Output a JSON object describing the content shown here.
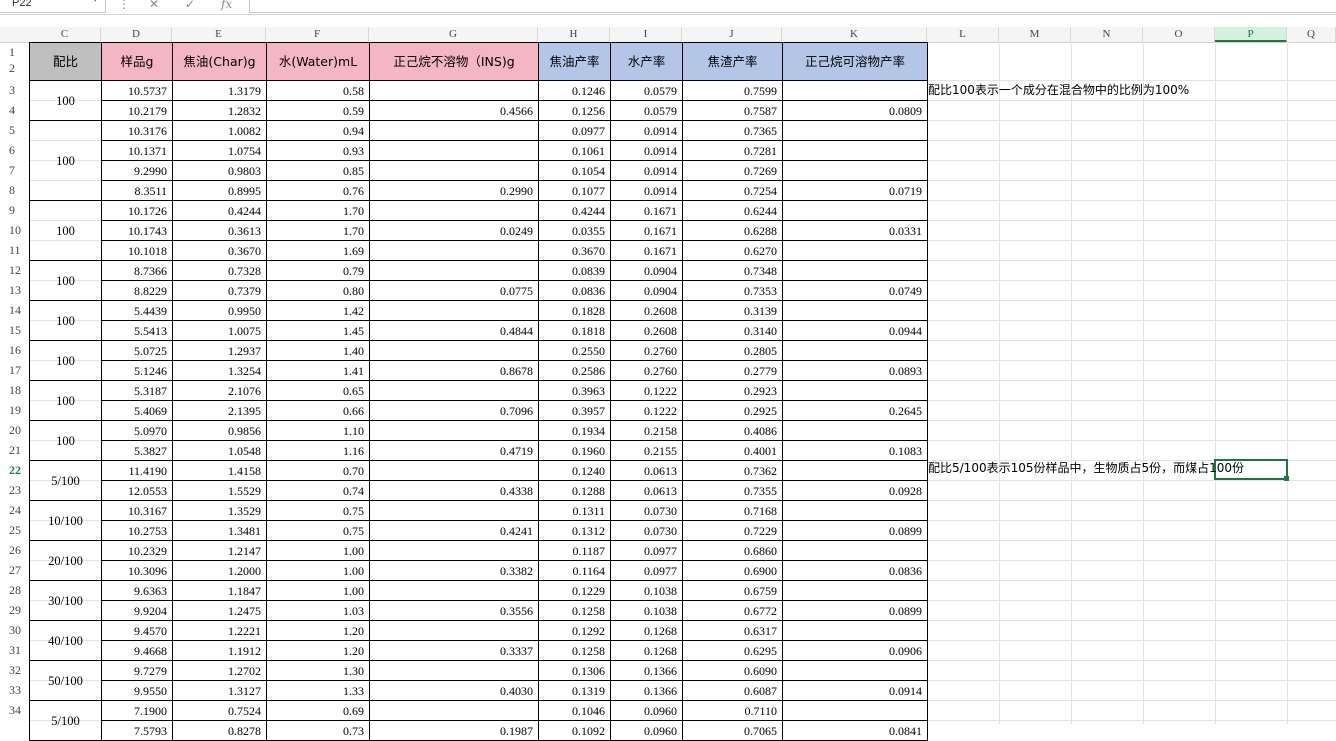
{
  "formula_bar": {
    "name_box": "P22",
    "cancel_icon": "✕",
    "confirm_icon": "✓",
    "fx_label": "fx",
    "formula": ""
  },
  "columns": [
    "C",
    "D",
    "E",
    "F",
    "G",
    "H",
    "I",
    "J",
    "K",
    "L",
    "M",
    "N",
    "O",
    "P",
    "Q"
  ],
  "selected_column": "P",
  "rows": [
    "1",
    "2",
    "3",
    "4",
    "5",
    "6",
    "7",
    "8",
    "9",
    "10",
    "11",
    "12",
    "13",
    "14",
    "15",
    "16",
    "17",
    "18",
    "19",
    "20",
    "21",
    "22",
    "23",
    "24",
    "25",
    "26",
    "27",
    "28",
    "29",
    "30",
    "31",
    "32",
    "33",
    "34",
    ""
  ],
  "selected_row": "22",
  "headers": {
    "ratio": "配比",
    "sample": "样品g",
    "char": "焦油(Char)g",
    "water": "水(Water)mL",
    "ins": "正己烷不溶物（INS)g",
    "char_yield": "焦油产率",
    "water_yield": "水产率",
    "residue_yield": "焦渣产率",
    "soluble_yield": "正己烷可溶物产率"
  },
  "groups": [
    {
      "ratio": "100",
      "rows": [
        {
          "sample": "10.5737",
          "char": "1.3179",
          "water": "0.58",
          "ins": "",
          "cy": "0.1246",
          "wy": "0.0579",
          "ry": "0.7599",
          "sy": ""
        },
        {
          "sample": "10.2179",
          "char": "1.2832",
          "water": "0.59",
          "ins": "0.4566",
          "cy": "0.1256",
          "wy": "0.0579",
          "ry": "0.7587",
          "sy": "0.0809"
        }
      ]
    },
    {
      "ratio": "100",
      "rows": [
        {
          "sample": "10.3176",
          "char": "1.0082",
          "water": "0.94",
          "ins": "",
          "cy": "0.0977",
          "wy": "0.0914",
          "ry": "0.7365",
          "sy": ""
        },
        {
          "sample": "10.1371",
          "char": "1.0754",
          "water": "0.93",
          "ins": "",
          "cy": "0.1061",
          "wy": "0.0914",
          "ry": "0.7281",
          "sy": ""
        },
        {
          "sample": "9.2990",
          "char": "0.9803",
          "water": "0.85",
          "ins": "",
          "cy": "0.1054",
          "wy": "0.0914",
          "ry": "0.7269",
          "sy": ""
        },
        {
          "sample": "8.3511",
          "char": "0.8995",
          "water": "0.76",
          "ins": "0.2990",
          "cy": "0.1077",
          "wy": "0.0914",
          "ry": "0.7254",
          "sy": "0.0719"
        }
      ]
    },
    {
      "ratio": "100",
      "rows": [
        {
          "sample": "10.1726",
          "char": "0.4244",
          "water": "1.70",
          "ins": "",
          "cy": "0.4244",
          "wy": "0.1671",
          "ry": "0.6244",
          "sy": ""
        },
        {
          "sample": "10.1743",
          "char": "0.3613",
          "water": "1.70",
          "ins": "0.0249",
          "cy": "0.0355",
          "wy": "0.1671",
          "ry": "0.6288",
          "sy": "0.0331"
        },
        {
          "sample": "10.1018",
          "char": "0.3670",
          "water": "1.69",
          "ins": "",
          "cy": "0.3670",
          "wy": "0.1671",
          "ry": "0.6270",
          "sy": ""
        }
      ]
    },
    {
      "ratio": "100",
      "rows": [
        {
          "sample": "8.7366",
          "char": "0.7328",
          "water": "0.79",
          "ins": "",
          "cy": "0.0839",
          "wy": "0.0904",
          "ry": "0.7348",
          "sy": ""
        },
        {
          "sample": "8.8229",
          "char": "0.7379",
          "water": "0.80",
          "ins": "0.0775",
          "cy": "0.0836",
          "wy": "0.0904",
          "ry": "0.7353",
          "sy": "0.0749"
        }
      ]
    },
    {
      "ratio": "100",
      "rows": [
        {
          "sample": "5.4439",
          "char": "0.9950",
          "water": "1.42",
          "ins": "",
          "cy": "0.1828",
          "wy": "0.2608",
          "ry": "0.3139",
          "sy": ""
        },
        {
          "sample": "5.5413",
          "char": "1.0075",
          "water": "1.45",
          "ins": "0.4844",
          "cy": "0.1818",
          "wy": "0.2608",
          "ry": "0.3140",
          "sy": "0.0944"
        }
      ]
    },
    {
      "ratio": "100",
      "rows": [
        {
          "sample": "5.0725",
          "char": "1.2937",
          "water": "1.40",
          "ins": "",
          "cy": "0.2550",
          "wy": "0.2760",
          "ry": "0.2805",
          "sy": ""
        },
        {
          "sample": "5.1246",
          "char": "1.3254",
          "water": "1.41",
          "ins": "0.8678",
          "cy": "0.2586",
          "wy": "0.2760",
          "ry": "0.2779",
          "sy": "0.0893"
        }
      ]
    },
    {
      "ratio": "100",
      "rows": [
        {
          "sample": "5.3187",
          "char": "2.1076",
          "water": "0.65",
          "ins": "",
          "cy": "0.3963",
          "wy": "0.1222",
          "ry": "0.2923",
          "sy": ""
        },
        {
          "sample": "5.4069",
          "char": "2.1395",
          "water": "0.66",
          "ins": "0.7096",
          "cy": "0.3957",
          "wy": "0.1222",
          "ry": "0.2925",
          "sy": "0.2645"
        }
      ]
    },
    {
      "ratio": "100",
      "rows": [
        {
          "sample": "5.0970",
          "char": "0.9856",
          "water": "1.10",
          "ins": "",
          "cy": "0.1934",
          "wy": "0.2158",
          "ry": "0.4086",
          "sy": ""
        },
        {
          "sample": "5.3827",
          "char": "1.0548",
          "water": "1.16",
          "ins": "0.4719",
          "cy": "0.1960",
          "wy": "0.2155",
          "ry": "0.4001",
          "sy": "0.1083"
        }
      ]
    },
    {
      "ratio": "5/100",
      "rows": [
        {
          "sample": "11.4190",
          "char": "1.4158",
          "water": "0.70",
          "ins": "",
          "cy": "0.1240",
          "wy": "0.0613",
          "ry": "0.7362",
          "sy": ""
        },
        {
          "sample": "12.0553",
          "char": "1.5529",
          "water": "0.74",
          "ins": "0.4338",
          "cy": "0.1288",
          "wy": "0.0613",
          "ry": "0.7355",
          "sy": "0.0928"
        }
      ]
    },
    {
      "ratio": "10/100",
      "rows": [
        {
          "sample": "10.3167",
          "char": "1.3529",
          "water": "0.75",
          "ins": "",
          "cy": "0.1311",
          "wy": "0.0730",
          "ry": "0.7168",
          "sy": ""
        },
        {
          "sample": "10.2753",
          "char": "1.3481",
          "water": "0.75",
          "ins": "0.4241",
          "cy": "0.1312",
          "wy": "0.0730",
          "ry": "0.7229",
          "sy": "0.0899"
        }
      ]
    },
    {
      "ratio": "20/100",
      "rows": [
        {
          "sample": "10.2329",
          "char": "1.2147",
          "water": "1.00",
          "ins": "",
          "cy": "0.1187",
          "wy": "0.0977",
          "ry": "0.6860",
          "sy": ""
        },
        {
          "sample": "10.3096",
          "char": "1.2000",
          "water": "1.00",
          "ins": "0.3382",
          "cy": "0.1164",
          "wy": "0.0977",
          "ry": "0.6900",
          "sy": "0.0836"
        }
      ]
    },
    {
      "ratio": "30/100",
      "rows": [
        {
          "sample": "9.6363",
          "char": "1.1847",
          "water": "1.00",
          "ins": "",
          "cy": "0.1229",
          "wy": "0.1038",
          "ry": "0.6759",
          "sy": ""
        },
        {
          "sample": "9.9204",
          "char": "1.2475",
          "water": "1.03",
          "ins": "0.3556",
          "cy": "0.1258",
          "wy": "0.1038",
          "ry": "0.6772",
          "sy": "0.0899"
        }
      ]
    },
    {
      "ratio": "40/100",
      "rows": [
        {
          "sample": "9.4570",
          "char": "1.2221",
          "water": "1.20",
          "ins": "",
          "cy": "0.1292",
          "wy": "0.1268",
          "ry": "0.6317",
          "sy": ""
        },
        {
          "sample": "9.4668",
          "char": "1.1912",
          "water": "1.20",
          "ins": "0.3337",
          "cy": "0.1258",
          "wy": "0.1268",
          "ry": "0.6295",
          "sy": "0.0906"
        }
      ]
    },
    {
      "ratio": "50/100",
      "rows": [
        {
          "sample": "9.7279",
          "char": "1.2702",
          "water": "1.30",
          "ins": "",
          "cy": "0.1306",
          "wy": "0.1366",
          "ry": "0.6090",
          "sy": ""
        },
        {
          "sample": "9.9550",
          "char": "1.3127",
          "water": "1.33",
          "ins": "0.4030",
          "cy": "0.1319",
          "wy": "0.1366",
          "ry": "0.6087",
          "sy": "0.0914"
        }
      ]
    },
    {
      "ratio": "5/100",
      "rows": [
        {
          "sample": "7.1900",
          "char": "0.7524",
          "water": "0.69",
          "ins": "",
          "cy": "0.1046",
          "wy": "0.0960",
          "ry": "0.7110",
          "sy": ""
        },
        {
          "sample": "7.5793",
          "char": "0.8278",
          "water": "0.73",
          "ins": "0.1987",
          "cy": "0.1092",
          "wy": "0.0960",
          "ry": "0.7065",
          "sy": "0.0841"
        }
      ]
    }
  ],
  "notes": {
    "note1": "配比100表示一个成分在混合物中的比例为100%",
    "note2": "配比5/100表示105份样品中，生物质占5份，而煤占100份"
  }
}
